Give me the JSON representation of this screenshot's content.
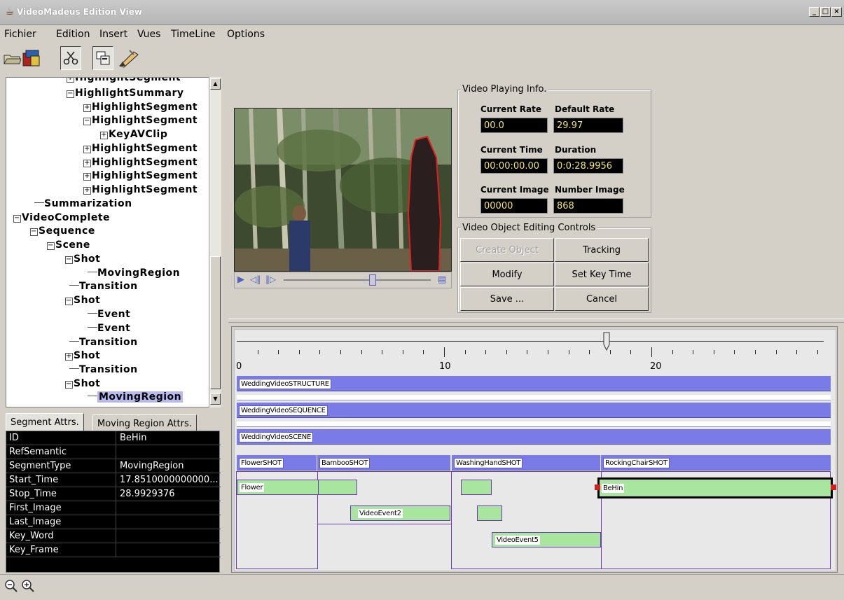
{
  "window": {
    "title": "VideoMadeus Edition View",
    "minimize": "_",
    "maximize": "□",
    "close": "×"
  },
  "menu": [
    "Fichier",
    "Edition",
    "Insert",
    "Vues",
    "TimeLine",
    "Options"
  ],
  "tree": {
    "nodes": [
      {
        "label": "HighlightSummary",
        "toggle": "−"
      },
      {
        "label": "HighlightSegment",
        "toggle": "+"
      },
      {
        "label": "HighlightSegment",
        "toggle": "−"
      },
      {
        "label": "KeyAVClip",
        "toggle": "+"
      },
      {
        "label": "HighlightSegment",
        "toggle": "+"
      },
      {
        "label": "HighlightSegment",
        "toggle": "+"
      },
      {
        "label": "HighlightSegment",
        "toggle": "+"
      },
      {
        "label": "HighlightSegment",
        "toggle": "+"
      },
      {
        "label": "Summarization",
        "toggle": ""
      },
      {
        "label": "VideoComplete",
        "toggle": "−"
      },
      {
        "label": "Sequence",
        "toggle": "−"
      },
      {
        "label": "Scene",
        "toggle": "−"
      },
      {
        "label": "Shot",
        "toggle": "−"
      },
      {
        "label": "MovingRegion",
        "toggle": ""
      },
      {
        "label": "Transition",
        "toggle": ""
      },
      {
        "label": "Shot",
        "toggle": "−"
      },
      {
        "label": "Event",
        "toggle": ""
      },
      {
        "label": "Event",
        "toggle": ""
      },
      {
        "label": "Transition",
        "toggle": ""
      },
      {
        "label": "Shot",
        "toggle": "+"
      },
      {
        "label": "Transition",
        "toggle": ""
      },
      {
        "label": "Shot",
        "toggle": "−"
      },
      {
        "label": "MovingRegion",
        "toggle": ""
      }
    ],
    "partial_top": "HighlightSegment"
  },
  "attr_tabs": [
    "Segment Attrs.",
    "Moving Region Attrs."
  ],
  "attributes": [
    {
      "key": "ID",
      "value": "BeHin"
    },
    {
      "key": "RefSemantic",
      "value": ""
    },
    {
      "key": "SegmentType",
      "value": "MovingRegion"
    },
    {
      "key": "Start_Time",
      "value": "17.8510000000000..."
    },
    {
      "key": "Stop_Time",
      "value": "28.9929376"
    },
    {
      "key": "First_Image",
      "value": ""
    },
    {
      "key": "Last_Image",
      "value": ""
    },
    {
      "key": "Key_Word",
      "value": ""
    },
    {
      "key": "Key_Frame",
      "value": ""
    }
  ],
  "video_info": {
    "title": "Video Playing Info.",
    "current_rate_label": "Current Rate",
    "current_rate": "00.0",
    "default_rate_label": "Default Rate",
    "default_rate": "29.97",
    "current_time_label": "Current Time",
    "current_time": "00:00:00.00",
    "duration_label": "Duration",
    "duration": "0:0:28.9956",
    "current_image_label": "Current Image",
    "current_image": "00000",
    "number_image_label": "Number Image",
    "number_image": "868"
  },
  "editing": {
    "title": "Video Object Editing Controls",
    "create": "Create Object",
    "tracking": "Tracking",
    "modify": "Modify",
    "set_key_time": "Set Key Time",
    "save": "Save ...",
    "cancel": "Cancel"
  },
  "timeline": {
    "tick_labels": [
      "0",
      "10",
      "20"
    ],
    "cursor_time": 17.85,
    "bars": {
      "structure": "WeddingVideoSTRUCTURE",
      "sequence": "WeddingVideoSEQUENCE",
      "scene": "WeddingVideoSCENE"
    },
    "shots": [
      "FlowerSHOT",
      "BambooSHOT",
      "WashingHandSHOT",
      "RockingChairSHOT"
    ],
    "events": {
      "flower": "Flower",
      "event2": "VideoEvent2",
      "event5": "VideoEvent5",
      "behin": "BeHin"
    }
  },
  "colors": {
    "bar": "#7b7be8",
    "event": "#a8e6a0",
    "info_value_text": "#f2e66a"
  }
}
